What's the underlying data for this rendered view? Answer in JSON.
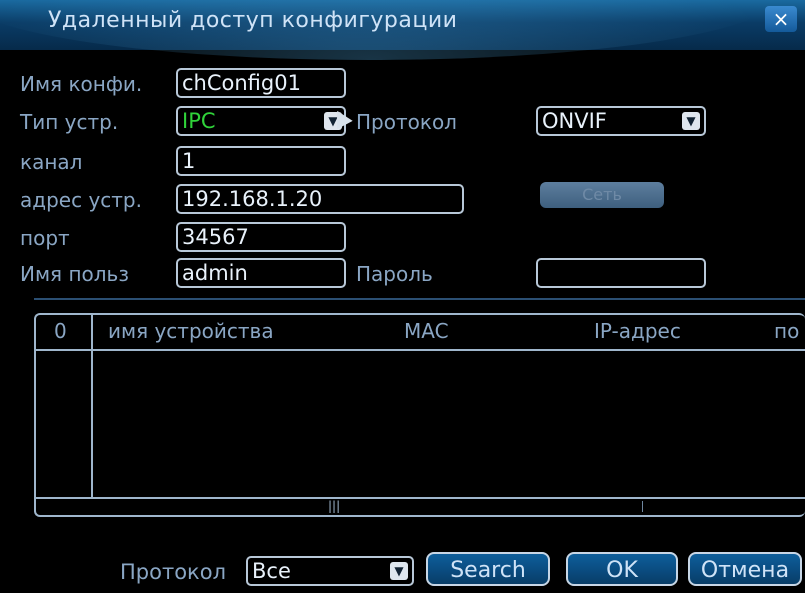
{
  "title": "Удаленный доступ конфигурации",
  "close_icon": "×",
  "form": {
    "config_name_label": "Имя конфи.",
    "config_name_value": "chConfig01",
    "device_type_label": "Тип устр.",
    "device_type_value": "IPC",
    "protocol_label": "Протокол",
    "protocol_value": "ONVIF",
    "channel_label": "канал",
    "channel_value": "1",
    "address_label": "адрес устр.",
    "address_value": "192.168.1.20",
    "disabled_button_label": "Сеть",
    "port_label": "порт",
    "port_value": "34567",
    "username_label": "Имя польз",
    "username_value": "admin",
    "password_label": "Пароль",
    "password_value": ""
  },
  "table": {
    "headers": [
      "0",
      "имя устройства",
      "MAC",
      "IP-адрес",
      "по"
    ],
    "rows": []
  },
  "footer": {
    "protocol_label": "Протокол",
    "protocol_value": "Все",
    "search_label": "Search",
    "ok_label": "OK",
    "cancel_label": "Отмена"
  },
  "colors": {
    "accent_blue": "#0a4a7d",
    "label_text": "#8aa6c4",
    "field_border": "#b8c8d8",
    "green_value": "#30d33a"
  },
  "icons": {
    "dropdown": "chevron-down-icon",
    "close": "close-icon",
    "cursor": "mouse-pointer-icon"
  }
}
